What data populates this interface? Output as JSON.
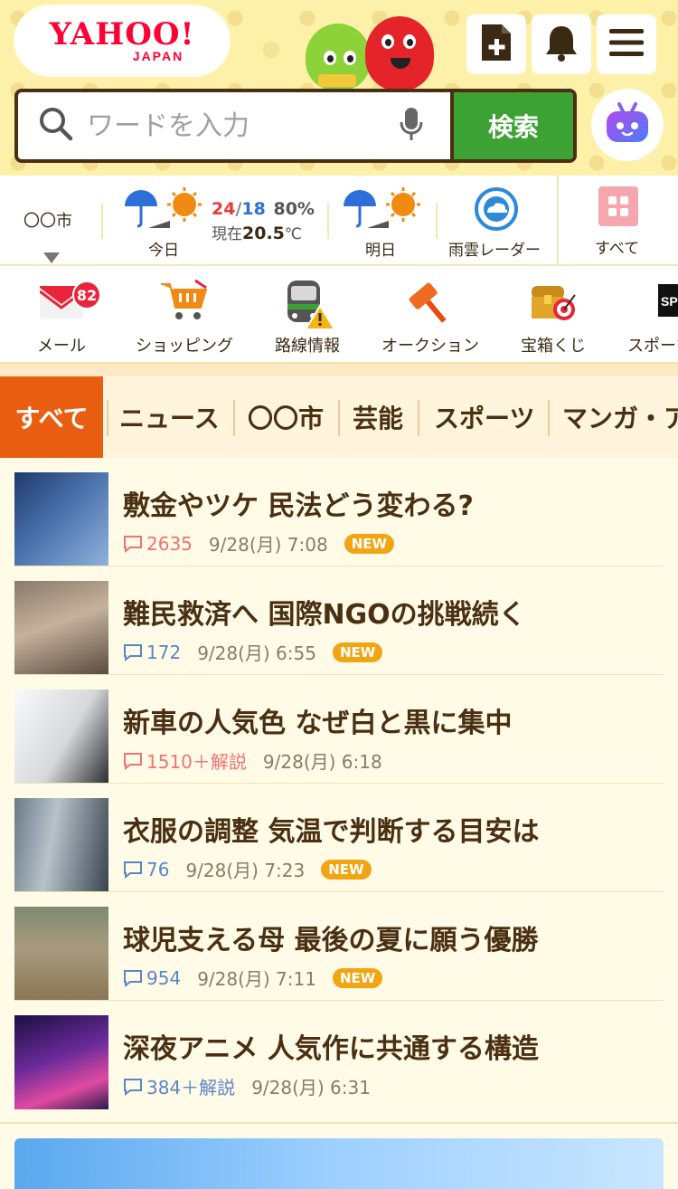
{
  "header": {
    "logo_main": "YAHOO!",
    "logo_sub": "JAPAN",
    "search": {
      "placeholder": "ワードを入力",
      "button_label": "検索"
    },
    "icons": [
      "add-page-icon",
      "bell-icon",
      "menu-icon",
      "ai-assistant-icon"
    ]
  },
  "weather": {
    "city": "〇〇市",
    "today": {
      "label": "今日",
      "high": "24",
      "slash": "/",
      "low": "18",
      "rain": "80%",
      "current_prefix": "現在",
      "current_temp": "20.5",
      "current_unit": "℃"
    },
    "tomorrow": {
      "label": "明日"
    },
    "radar": {
      "label": "雨雲レーダー"
    },
    "all": {
      "label": "すべて"
    }
  },
  "services": [
    {
      "label": "メール",
      "badge": "82"
    },
    {
      "label": "ショッピング"
    },
    {
      "label": "路線情報"
    },
    {
      "label": "オークション"
    },
    {
      "label": "宝箱くじ"
    },
    {
      "label": "スポーツ"
    }
  ],
  "tabs": [
    "すべて",
    "ニュース",
    "〇〇市",
    "芸能",
    "スポーツ",
    "マンガ・ア"
  ],
  "news": [
    {
      "title": "敷金やツケ 民法どう変わる?",
      "comments": "2635",
      "comment_style": "hot",
      "time": "9/28(月) 7:08",
      "badge": "NEW"
    },
    {
      "title": "難民救済へ 国際NGOの挑戦続く",
      "comments": "172",
      "comment_style": "cool",
      "time": "9/28(月) 6:55",
      "badge": "NEW"
    },
    {
      "title": "新車の人気色 なぜ白と黒に集中",
      "comments": "1510＋解説",
      "comment_style": "hot",
      "time": "9/28(月) 6:18",
      "badge": ""
    },
    {
      "title": "衣服の調整 気温で判断する目安は",
      "comments": "76",
      "comment_style": "cool",
      "time": "9/28(月) 7:23",
      "badge": "NEW"
    },
    {
      "title": "球児支える母 最後の夏に願う優勝",
      "comments": "954",
      "comment_style": "cool",
      "time": "9/28(月) 7:11",
      "badge": "NEW"
    },
    {
      "title": "深夜アニメ 人気作に共通する構造",
      "comments": "384＋解説",
      "comment_style": "cool",
      "time": "9/28(月) 6:31",
      "badge": ""
    }
  ],
  "colors": {
    "accent_orange": "#e95e10",
    "search_green": "#3da234",
    "brand_red": "#ff0033",
    "new_badge": "#f1a513"
  }
}
